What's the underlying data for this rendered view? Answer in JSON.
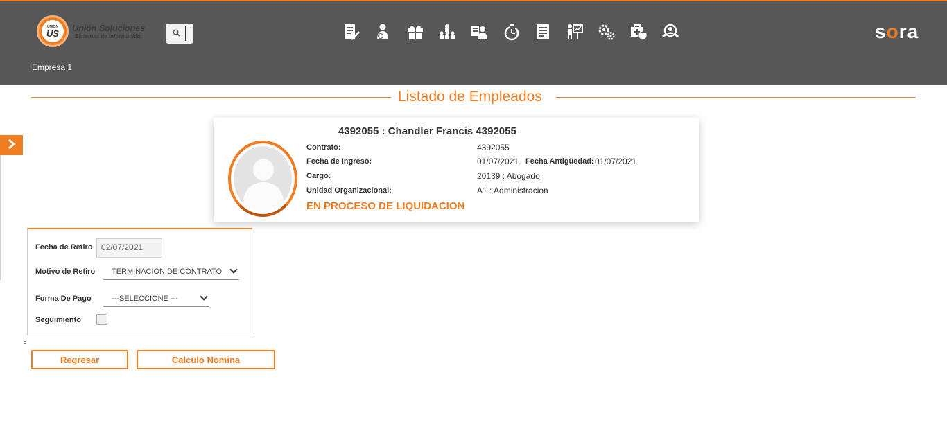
{
  "header": {
    "logo_title": "Unión Soluciones",
    "logo_subtitle": "Sistemas de Información",
    "logo_mark_top": "UNION",
    "logo_mark_main": "US",
    "brand_prefix": "s",
    "brand_o": "o",
    "brand_suffix": "ra",
    "company": "Empresa 1",
    "nav_icons": [
      "document-edit-icon",
      "employee-money-icon",
      "gift-icon",
      "org-chart-icon",
      "id-card-person-icon",
      "stopwatch-icon",
      "report-list-icon",
      "presentation-icon",
      "gears-icon",
      "medical-kit-shield-icon",
      "user-search-icon"
    ]
  },
  "section": {
    "title": "Listado de Empleados"
  },
  "employee": {
    "name": "4392055 : Chandler Francis 4392055",
    "contrato_label": "Contrato:",
    "contrato_value": "4392055",
    "ingreso_label": "Fecha de Ingreso:",
    "ingreso_value": "01/07/2021",
    "antiguedad_label": "Fecha Antigüedad:",
    "antiguedad_value": "01/07/2021",
    "cargo_label": "Cargo:",
    "cargo_value": "20139 : Abogado",
    "unidad_label": "Unidad Organizacional:",
    "unidad_value": "A1 : Administracion",
    "status": "EN PROCESO DE LIQUIDACION"
  },
  "form": {
    "fecha_retiro_label": "Fecha de Retiro",
    "fecha_retiro_value": "02/07/2021",
    "motivo_label": "Motivo de Retiro",
    "motivo_value": "TERMINACION DE CONTRATO",
    "forma_pago_label": "Forma De Pago",
    "forma_pago_value": "---SELECCIONE ---",
    "seguimiento_label": "Seguimiento",
    "seguimiento_checked": false
  },
  "actions": {
    "back_label": "Regresar",
    "calc_label": "Calculo Nomina"
  },
  "colors": {
    "accent": "#ef7d22",
    "header_bg": "#575757"
  }
}
